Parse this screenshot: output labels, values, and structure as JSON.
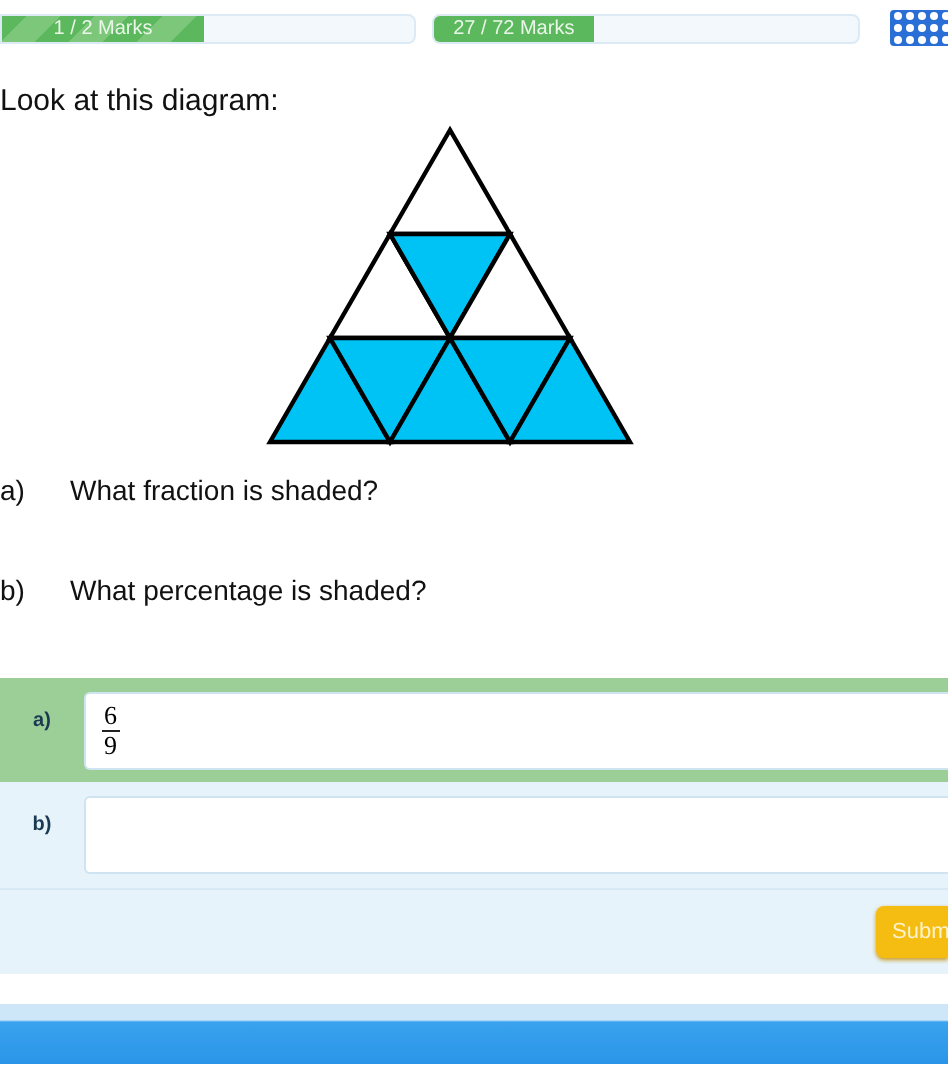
{
  "progress": [
    {
      "label": "1 / 2 Marks",
      "level": 0.49,
      "striped": true
    },
    {
      "label": "27 / 72 Marks",
      "level": 0.375,
      "striped": false
    }
  ],
  "question": {
    "intro": "Look at this diagram:",
    "diagram": {
      "rows": [
        [
          false
        ],
        [
          false,
          true,
          false
        ],
        [
          true,
          true,
          true,
          true,
          true
        ]
      ]
    },
    "parts": [
      {
        "label": "a)",
        "text": "What fraction is shaded?"
      },
      {
        "label": "b)",
        "text": "What percentage is shaded?"
      }
    ]
  },
  "answers": [
    {
      "label": "a)",
      "numerator": "6",
      "denominator": "9",
      "correct": true
    },
    {
      "label": "b)",
      "correct": false
    }
  ],
  "submit": "Subm"
}
